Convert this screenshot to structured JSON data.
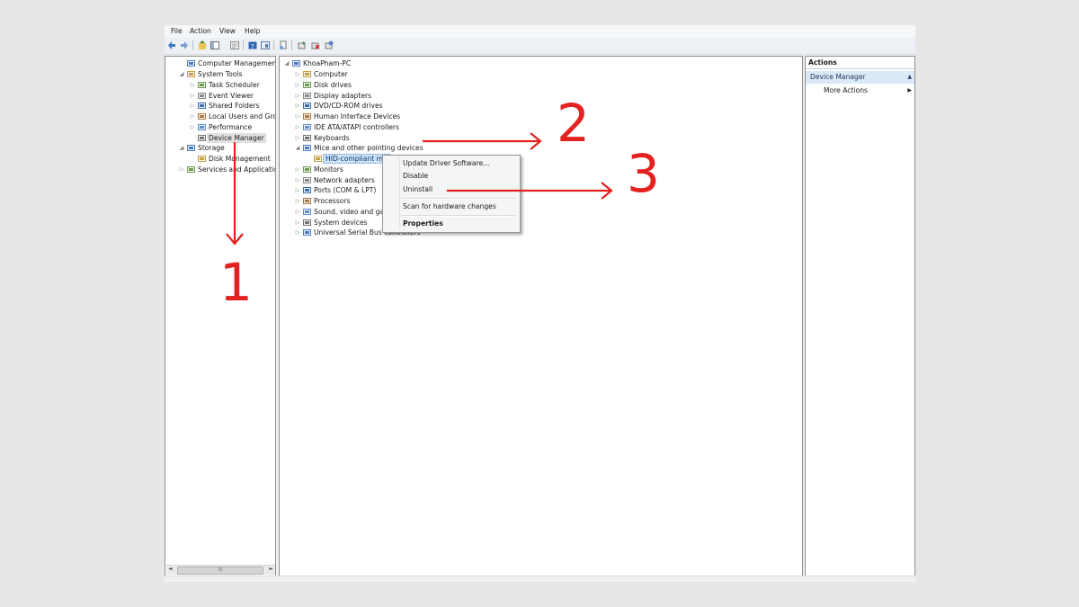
{
  "menu": [
    "File",
    "Action",
    "View",
    "Help"
  ],
  "toolbar_icons": [
    "back-icon",
    "forward-icon",
    "up-folder-icon",
    "console-tree-icon",
    "export-icon",
    "help-icon",
    "show-hide-icon",
    "properties-icon",
    "scan-icon",
    "update-driver-icon",
    "uninstall-icon",
    "disable-icon"
  ],
  "left_tree": {
    "items": [
      {
        "label": "Computer Management (Local",
        "icon": "computer-management-icon"
      },
      {
        "label": "System Tools",
        "icon": "tools-icon"
      },
      {
        "label": "Task Scheduler",
        "icon": "clock-icon"
      },
      {
        "label": "Event Viewer",
        "icon": "event-viewer-icon"
      },
      {
        "label": "Shared Folders",
        "icon": "shared-folder-icon"
      },
      {
        "label": "Local Users and Groups",
        "icon": "users-icon"
      },
      {
        "label": "Performance",
        "icon": "performance-icon"
      },
      {
        "label": "Device Manager",
        "icon": "device-manager-icon"
      },
      {
        "label": "Storage",
        "icon": "storage-icon"
      },
      {
        "label": "Disk Management",
        "icon": "disk-icon"
      },
      {
        "label": "Services and Applications",
        "icon": "services-icon"
      }
    ],
    "scroll_thumb": "III"
  },
  "device_tree": {
    "items": [
      {
        "label": "KhoaPham-PC",
        "icon": "computer-icon"
      },
      {
        "label": "Computer",
        "icon": "computer-icon"
      },
      {
        "label": "Disk drives",
        "icon": "disk-drive-icon"
      },
      {
        "label": "Display adapters",
        "icon": "display-icon"
      },
      {
        "label": "DVD/CD-ROM drives",
        "icon": "dvd-icon"
      },
      {
        "label": "Human Interface Devices",
        "icon": "hid-icon"
      },
      {
        "label": "IDE ATA/ATAPI controllers",
        "icon": "ide-icon"
      },
      {
        "label": "Keyboards",
        "icon": "keyboard-icon"
      },
      {
        "label": "Mice and other pointing devices",
        "icon": "mouse-icon"
      },
      {
        "label": "HID-compliant mo",
        "icon": "mouse-icon"
      },
      {
        "label": "Monitors",
        "icon": "monitor-icon"
      },
      {
        "label": "Network adapters",
        "icon": "network-icon"
      },
      {
        "label": "Ports (COM & LPT)",
        "icon": "port-icon"
      },
      {
        "label": "Processors",
        "icon": "processor-icon"
      },
      {
        "label": "Sound, video and gam",
        "icon": "sound-icon"
      },
      {
        "label": "System devices",
        "icon": "system-icon"
      },
      {
        "label": "Universal Serial Bus controllers",
        "icon": "usb-icon"
      }
    ]
  },
  "context_menu": {
    "update": "Update Driver Software...",
    "disable": "Disable",
    "uninstall": "Uninstall",
    "scan": "Scan for hardware changes",
    "properties": "Properties"
  },
  "actions_pane": {
    "header": "Actions",
    "selected": "Device Manager",
    "more": "More Actions"
  },
  "annotations": {
    "one": "1",
    "two": "2",
    "three": "3"
  },
  "colors": {
    "annotation": "#e32121",
    "selection": "#cce4f7",
    "actions_selected": "#dbe8f5"
  }
}
